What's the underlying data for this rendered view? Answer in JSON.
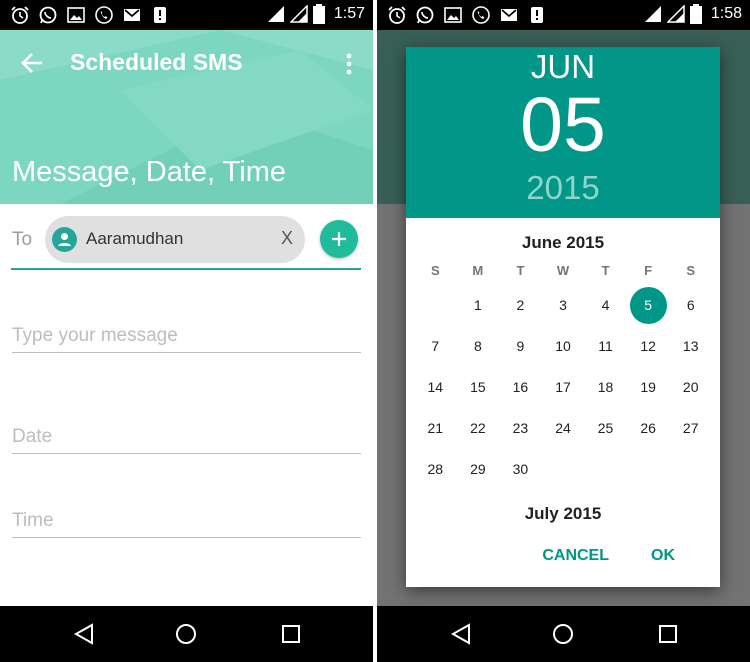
{
  "left": {
    "status_bar": {
      "time": "1:57"
    },
    "app_bar": {
      "title": "Scheduled SMS",
      "header": "Message, Date, Time"
    },
    "form": {
      "to_label": "To",
      "recipient_name": "Aaramudhan",
      "remove_label": "X",
      "message_placeholder": "Type your message",
      "date_placeholder": "Date",
      "time_placeholder": "Time"
    }
  },
  "right": {
    "status_bar": {
      "time": "1:58"
    },
    "date_picker": {
      "header_month": "JUN",
      "header_day": "05",
      "header_year": "2015",
      "calendar_month": "June 2015",
      "weekdays": [
        "S",
        "M",
        "T",
        "W",
        "T",
        "F",
        "S"
      ],
      "leading_blank_days": 1,
      "days": [
        "1",
        "2",
        "3",
        "4",
        "5",
        "6",
        "7",
        "8",
        "9",
        "10",
        "11",
        "12",
        "13",
        "14",
        "15",
        "16",
        "17",
        "18",
        "19",
        "20",
        "21",
        "22",
        "23",
        "24",
        "25",
        "26",
        "27",
        "28",
        "29",
        "30"
      ],
      "selected_day": "5",
      "next_month": "July 2015",
      "cancel_label": "CANCEL",
      "ok_label": "OK"
    }
  },
  "icons": {
    "status_left": [
      "alarm-icon",
      "whatsapp-icon",
      "image-icon",
      "call-icon",
      "gmail-icon",
      "sms-alert-icon"
    ],
    "status_right": [
      "wifi-icon",
      "signal-icon",
      "battery-icon"
    ],
    "nav": [
      "back-triangle-icon",
      "home-circle-icon",
      "recents-square-icon"
    ]
  },
  "colors": {
    "app_bar": "#7dd6c0",
    "accent": "#26a69a",
    "fab": "#1fbc9c",
    "dialog_header": "#009688",
    "year_dim": "#8fd3cb"
  }
}
